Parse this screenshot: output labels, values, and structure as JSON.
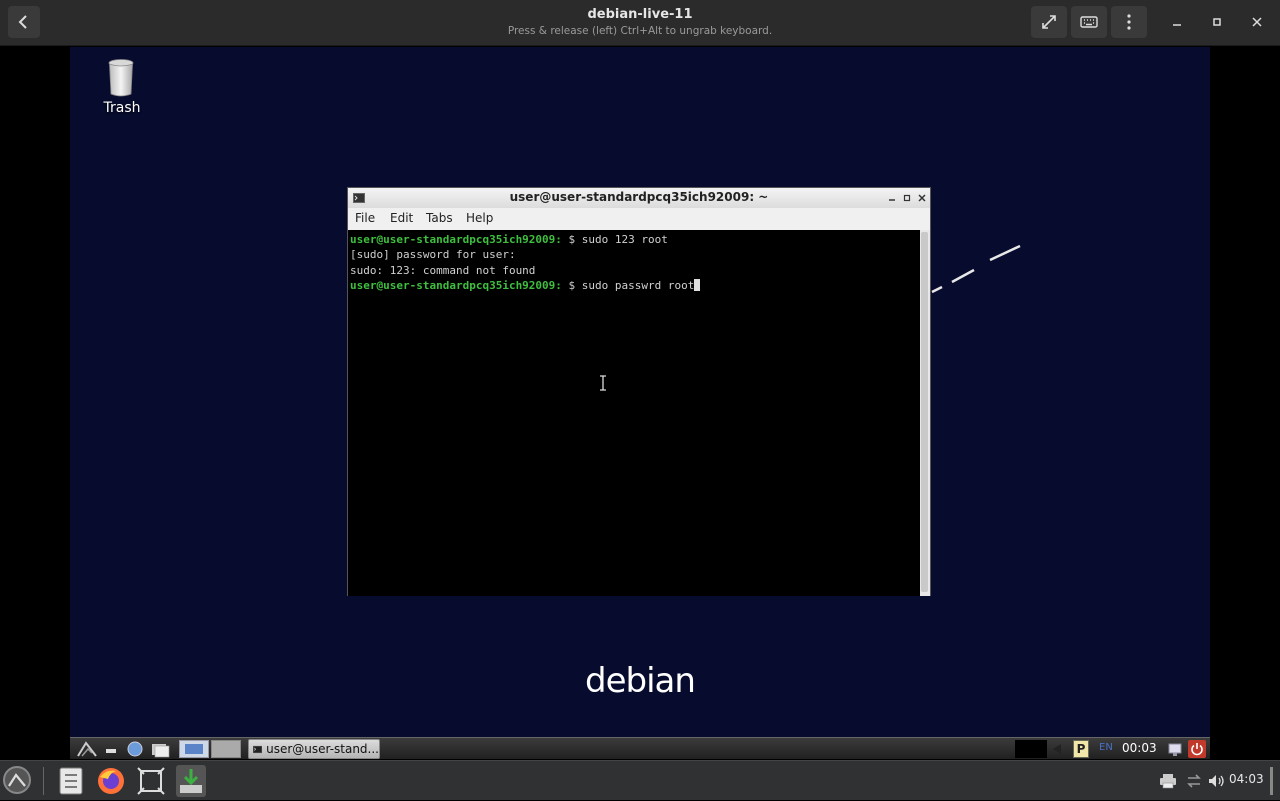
{
  "viewer": {
    "title": "debian-live-11",
    "subtitle": "Press & release (left) Ctrl+Alt to ungrab keyboard.",
    "icons": [
      "back-icon",
      "fullscreen-icon",
      "keyboard-icon",
      "more-vert-icon",
      "minimize-icon",
      "maximize-icon",
      "close-icon"
    ]
  },
  "desktop": {
    "trash_label": "Trash",
    "logo_text": "debian",
    "bg_color": "#070c2f"
  },
  "terminal": {
    "title": "user@user-standardpcq35ich92009: ~",
    "menu": [
      "File",
      "Edit",
      "Tabs",
      "Help"
    ],
    "lines": [
      {
        "prompt": "user@user-standardpcq35ich92009:",
        "rest": " $ sudo 123 root"
      },
      {
        "text": "[sudo] password for user:"
      },
      {
        "text": "sudo: 123: command not found"
      },
      {
        "prompt": "user@user-standardpcq35ich92009:",
        "rest": " $ sudo passwrd root"
      }
    ]
  },
  "guest_panel": {
    "task_label": "user@user-stand...",
    "lang": "EN",
    "clock": "00:03"
  },
  "host_dock": {
    "time": "04:03"
  }
}
